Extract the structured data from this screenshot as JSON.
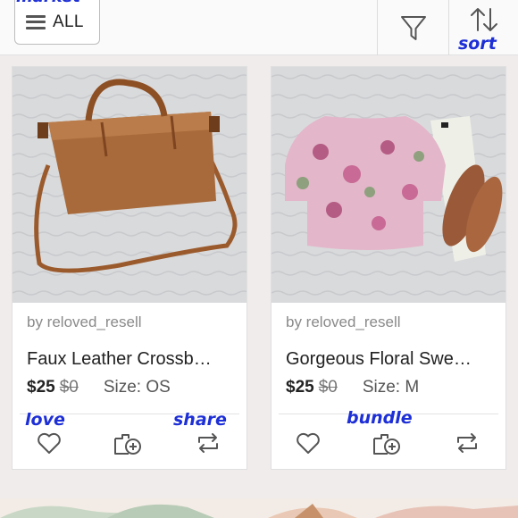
{
  "header": {
    "menu_label": "ALL",
    "annotation_top": "market",
    "sort_annotation": "sort"
  },
  "icons": {
    "menu": "hamburger-icon",
    "filter": "filter-icon",
    "sort": "sort-arrows-icon",
    "like": "heart-icon",
    "bundle": "bundle-add-icon",
    "share": "share-repost-icon"
  },
  "annotations": {
    "love": "love",
    "share": "share",
    "bundle": "bundle"
  },
  "listings": [
    {
      "seller": "by reloved_resell",
      "title": "Faux Leather Crossb…",
      "price": "$25",
      "original_price": "$0",
      "size": "Size: OS"
    },
    {
      "seller": "by reloved_resell",
      "title": "Gorgeous Floral Swe…",
      "price": "$25",
      "original_price": "$0",
      "size": "Size: M"
    }
  ],
  "colors": {
    "annotation_ink": "#1d2fd6",
    "card_bg": "#ffffff",
    "page_bg": "#efeceb"
  }
}
